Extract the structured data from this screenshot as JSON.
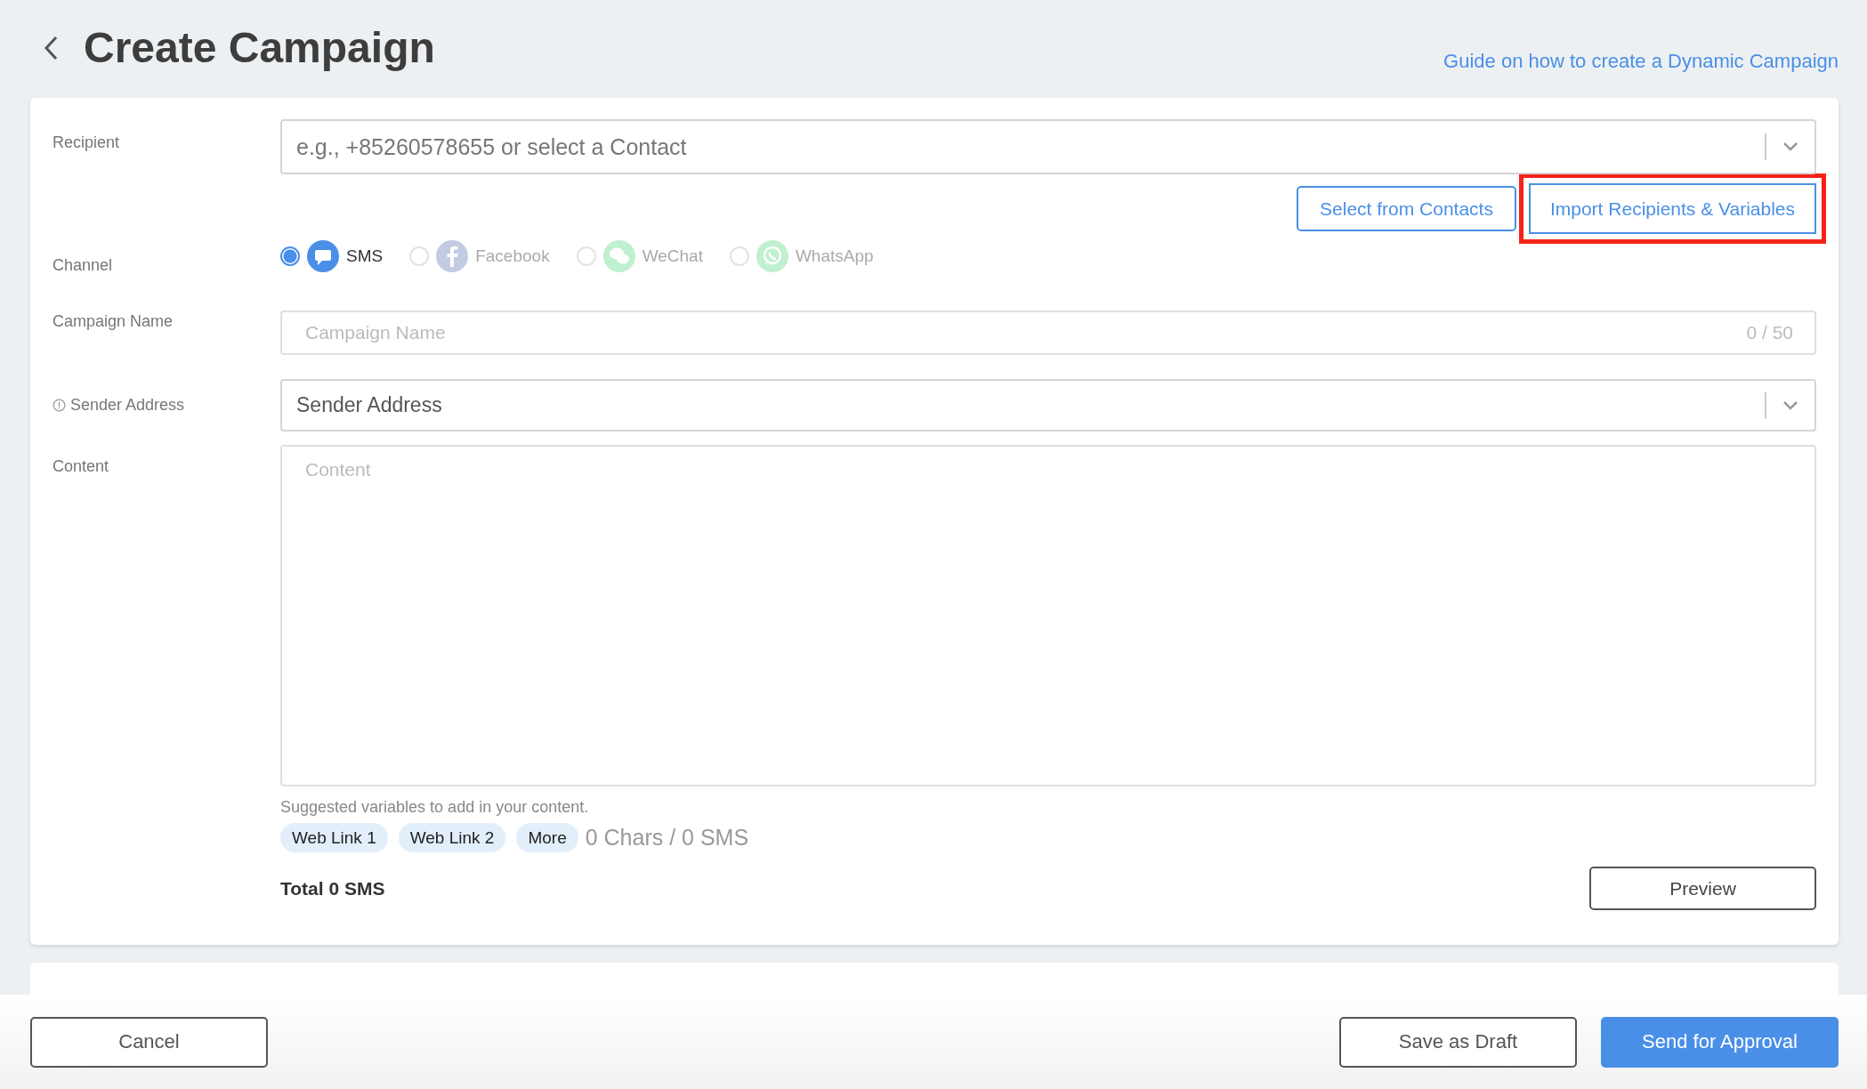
{
  "header": {
    "title": "Create Campaign",
    "guide_link": "Guide on how to create a Dynamic Campaign"
  },
  "recipient": {
    "label": "Recipient",
    "placeholder": "e.g., +85260578655 or select a Contact",
    "buttons": [
      {
        "label": "Select from Contacts",
        "highlighted": false
      },
      {
        "label": "Import Recipients & Variables",
        "highlighted": true
      }
    ]
  },
  "channel": {
    "label": "Channel",
    "options": [
      {
        "label": "SMS",
        "kind": "sms",
        "selected": true
      },
      {
        "label": "Facebook",
        "kind": "facebook",
        "selected": false
      },
      {
        "label": "WeChat",
        "kind": "wechat",
        "selected": false
      },
      {
        "label": "WhatsApp",
        "kind": "whatsapp",
        "selected": false
      }
    ]
  },
  "campaign_name": {
    "label": "Campaign Name",
    "placeholder": "Campaign Name",
    "counter": "0 / 50"
  },
  "sender_address": {
    "label": "Sender Address",
    "placeholder": "Sender Address"
  },
  "content": {
    "label": "Content",
    "placeholder": "Content",
    "hint": "Suggested variables to add in your content.",
    "chips": [
      "Web Link 1",
      "Web Link 2",
      "More"
    ],
    "count": "0 Chars / 0 SMS",
    "total": "Total 0 SMS",
    "preview_button": "Preview"
  },
  "footer": {
    "cancel": "Cancel",
    "save_draft": "Save as Draft",
    "send": "Send for Approval"
  }
}
